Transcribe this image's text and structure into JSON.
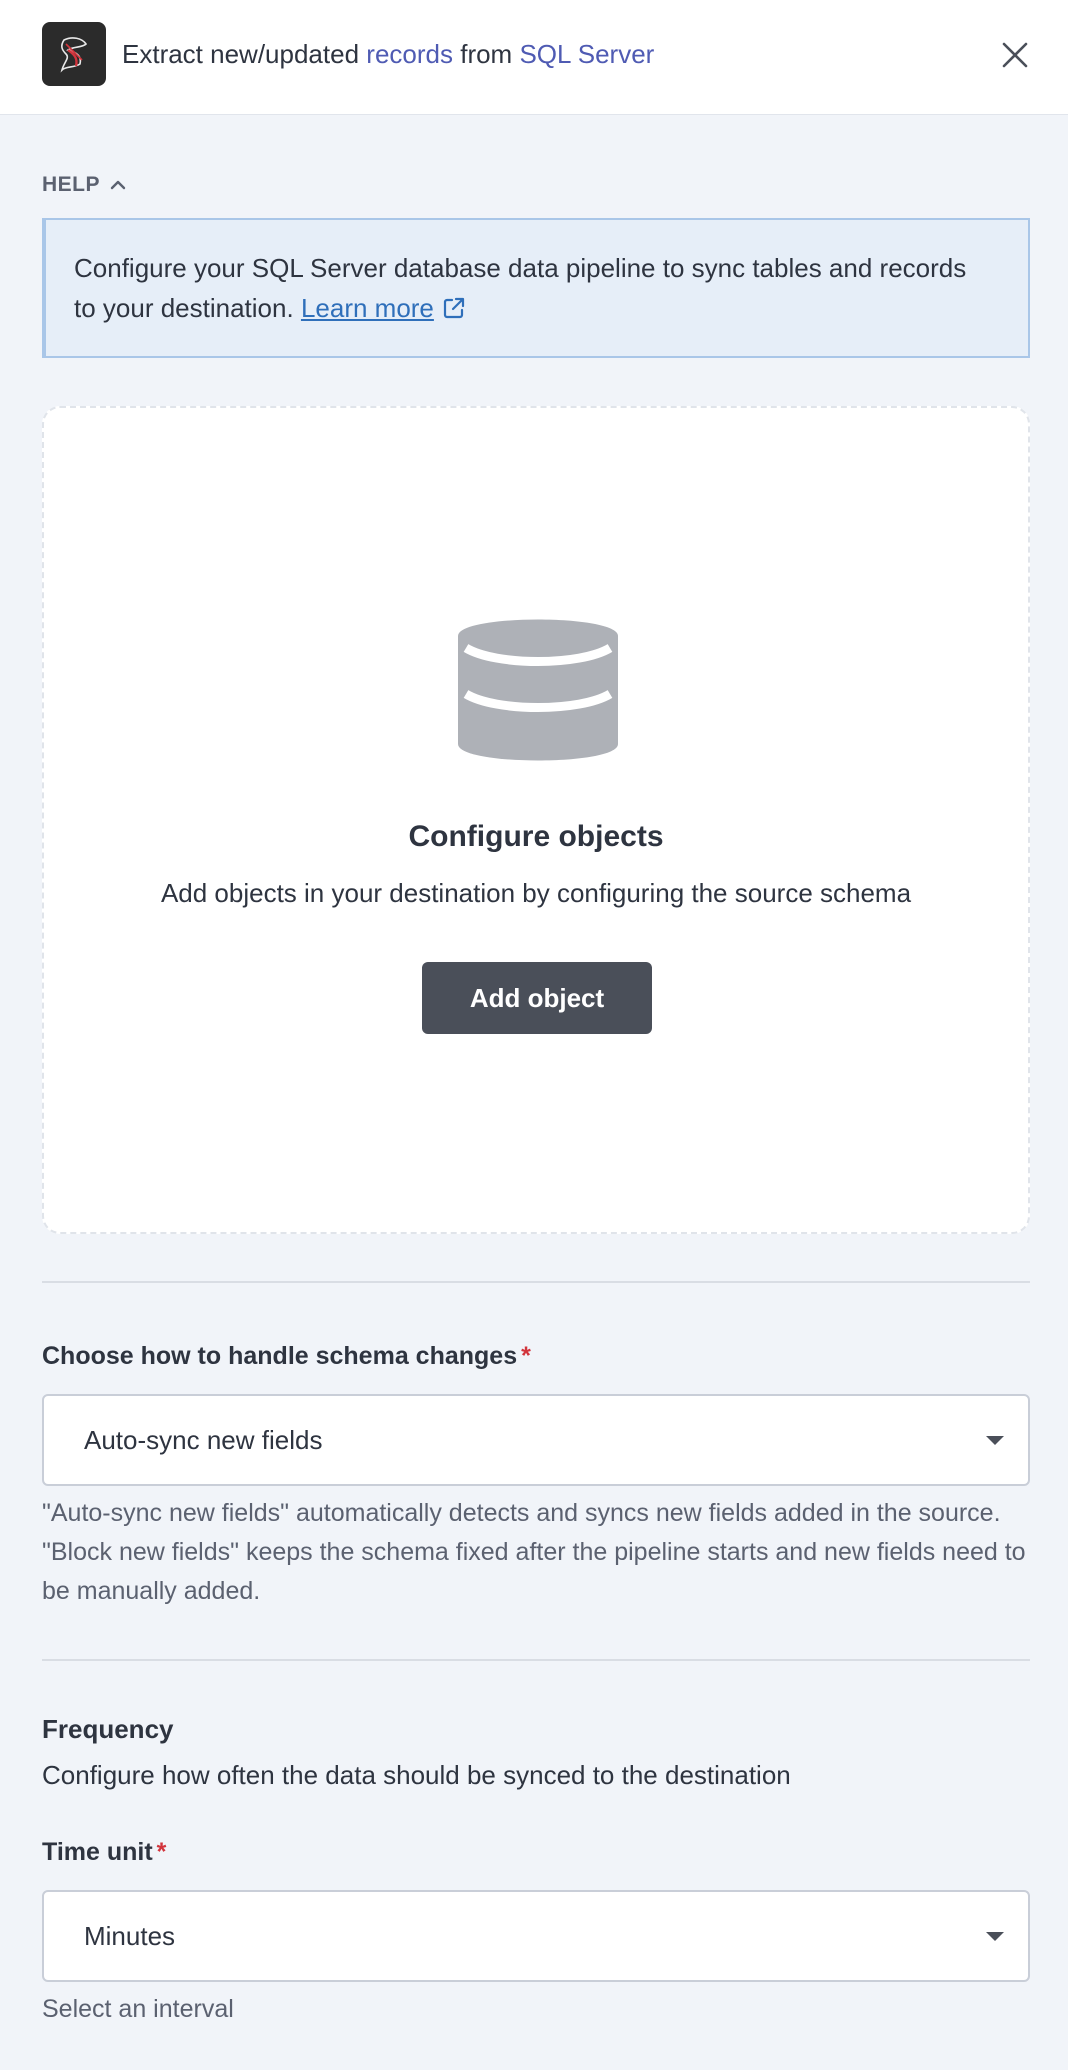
{
  "header": {
    "title_prefix": "Extract new/updated",
    "title_object": "records",
    "title_middle": "from",
    "title_source": "SQL Server",
    "logo_icon": "sql-server-logo",
    "close_icon": "close-icon"
  },
  "help": {
    "toggle_label": "HELP",
    "text": "Configure your SQL Server database data pipeline to sync tables and records to your destination.",
    "link_label": "Learn more"
  },
  "objects": {
    "icon": "database-icon",
    "title": "Configure objects",
    "description": "Add objects in your destination by configuring the source schema",
    "add_button_label": "Add object"
  },
  "schema_changes": {
    "label": "Choose how to handle schema changes",
    "required_mark": "*",
    "selected_value": "Auto-sync new fields",
    "helper": "\"Auto-sync new fields\" automatically detects and syncs new fields added in the source. \"Block new fields\" keeps the schema fixed after the pipeline starts and new fields need to be manually added."
  },
  "frequency": {
    "title": "Frequency",
    "description": "Configure how often the data should be synced to the destination",
    "time_unit_label": "Time unit",
    "required_mark": "*",
    "time_unit_value": "Minutes",
    "interval_label": "Select an interval"
  },
  "colors": {
    "accent": "#4f5bb3",
    "link": "#2f6fba",
    "required": "#d2343c",
    "button": "#4a4f59",
    "page_bg": "#f1f4f9"
  }
}
